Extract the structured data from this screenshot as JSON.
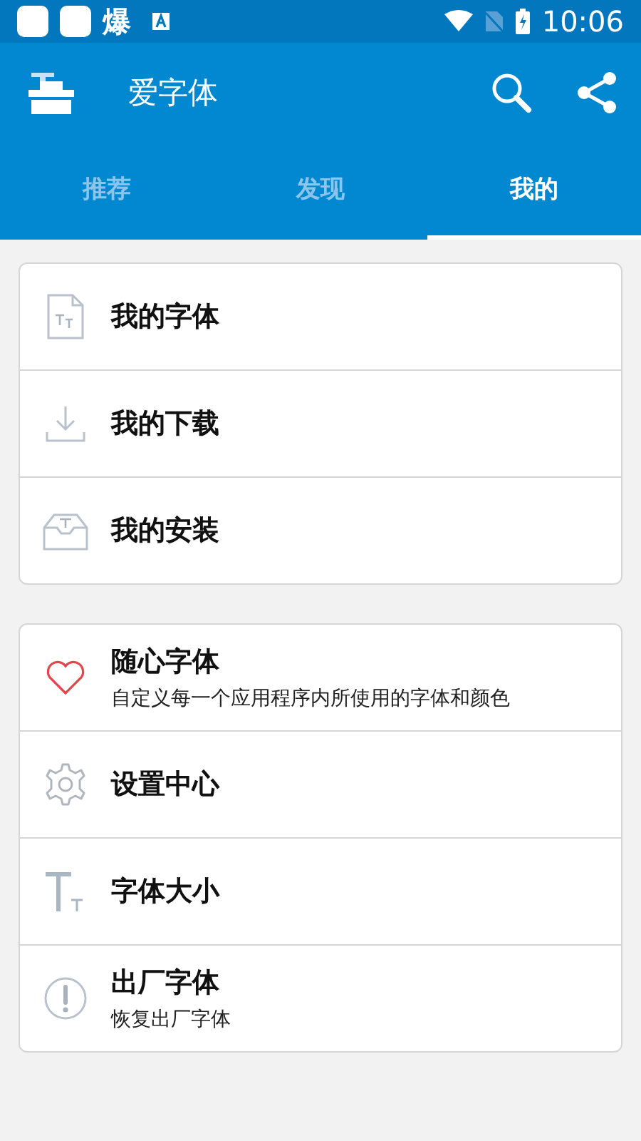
{
  "status_bar": {
    "app_glyph": "爆",
    "time": "10:06"
  },
  "app_bar": {
    "title": "爱字体"
  },
  "tabs": [
    {
      "label": "推荐",
      "selected": false
    },
    {
      "label": "发现",
      "selected": false
    },
    {
      "label": "我的",
      "selected": true
    }
  ],
  "sections": [
    {
      "items": [
        {
          "title": "我的字体"
        },
        {
          "title": "我的下载"
        },
        {
          "title": "我的安装"
        }
      ]
    },
    {
      "items": [
        {
          "title": "随心字体",
          "subtitle": "自定义每一个应用程序内所使用的字体和颜色"
        },
        {
          "title": "设置中心"
        },
        {
          "title": "字体大小"
        },
        {
          "title": "出厂字体",
          "subtitle": "恢复出厂字体"
        }
      ]
    }
  ]
}
